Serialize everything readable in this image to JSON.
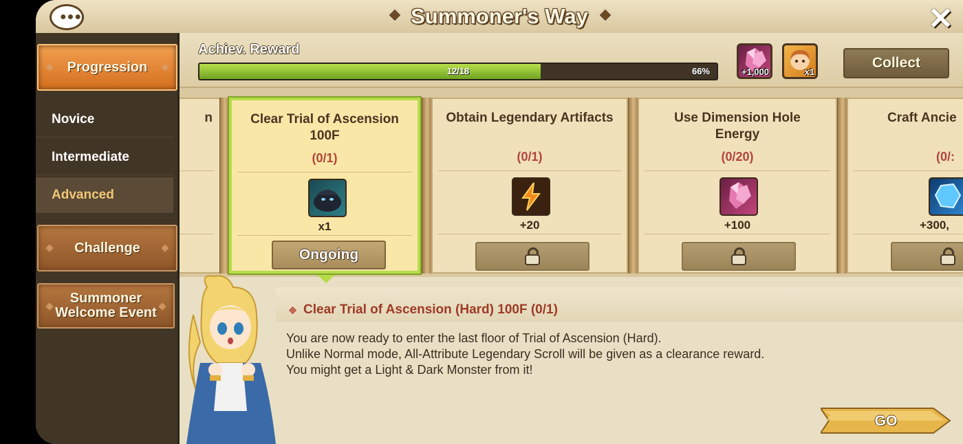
{
  "window": {
    "title": "Summoner's Way"
  },
  "sidebar": {
    "tabs": [
      {
        "label": "Progression",
        "active": true
      },
      {
        "label": "Challenge",
        "active": false
      },
      {
        "label": "Summoner Welcome Event",
        "active": false
      }
    ],
    "subitems": [
      {
        "label": "Novice",
        "active": false
      },
      {
        "label": "Intermediate",
        "active": false
      },
      {
        "label": "Advanced",
        "active": true
      }
    ]
  },
  "achievement": {
    "label": "Achiev. Reward",
    "progress_text": "12/18",
    "percent_text": "66%",
    "fill_fraction": 0.66,
    "rewards": [
      {
        "icon": "crystal-icon",
        "count": "+1,000"
      },
      {
        "icon": "summoner-portrait-icon",
        "count": "x1"
      }
    ],
    "collect_label": "Collect"
  },
  "cards": [
    {
      "title": "n",
      "progress": "",
      "amount": "",
      "partial": true
    },
    {
      "title": "Clear Trial of Ascension 100F",
      "progress": "(0/1)",
      "icon": "dark-slime-icon",
      "amount": "x1",
      "button": "Ongoing",
      "locked": false,
      "selected": true
    },
    {
      "title": "Obtain Legendary Artifacts",
      "progress": "(0/1)",
      "icon": "energy-bolt-icon",
      "amount": "+20",
      "locked": true
    },
    {
      "title": "Use Dimension Hole Energy",
      "progress": "(0/20)",
      "icon": "crystal-icon",
      "amount": "+100",
      "locked": true
    },
    {
      "title": "Craft Ancie",
      "progress": "(0/:",
      "icon": "blue-gem-icon",
      "amount": "+300,",
      "locked": true,
      "partial": true
    }
  ],
  "description": {
    "title": "Clear Trial of Ascension (Hard) 100F (0/1)",
    "lines": [
      "You are now ready to enter the last floor of Trial of Ascension (Hard).",
      "Unlike Normal mode, All-Attribute Legendary Scroll will be given as a clearance reward.",
      "You might get a Light & Dark Monster from it!"
    ],
    "go_label": "GO"
  },
  "colors": {
    "accent_orange": "#e0822f",
    "progress_green": "#8fc43a",
    "title_red": "#9e3a26",
    "selected_border": "#b7dc4a"
  }
}
